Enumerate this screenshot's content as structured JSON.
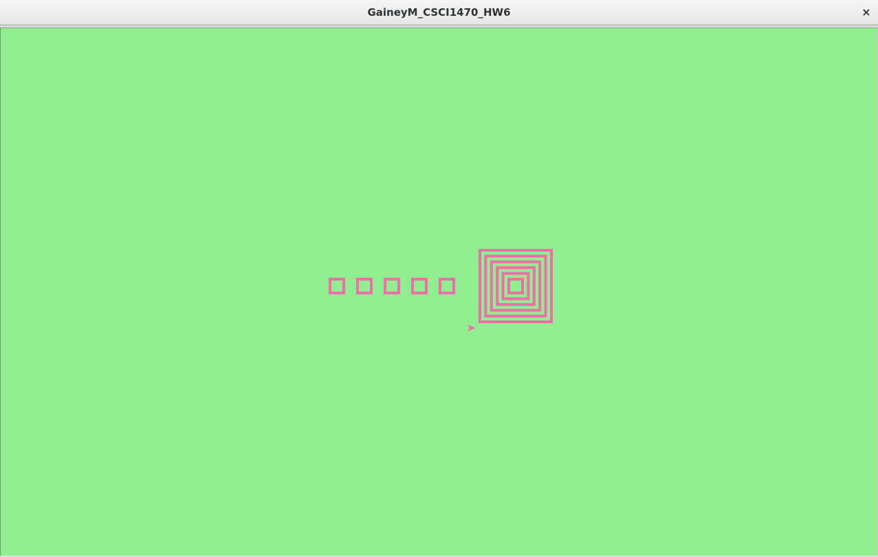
{
  "window": {
    "title": "GaineyM_CSCI1470_HW6",
    "close_glyph": "×"
  },
  "canvas": {
    "background_color": "#90ee90",
    "pen_color": "#f06ea8",
    "turtle_icon": "arrowhead-cursor-icon",
    "small_square_count": 5,
    "concentric_square_count": 6
  }
}
